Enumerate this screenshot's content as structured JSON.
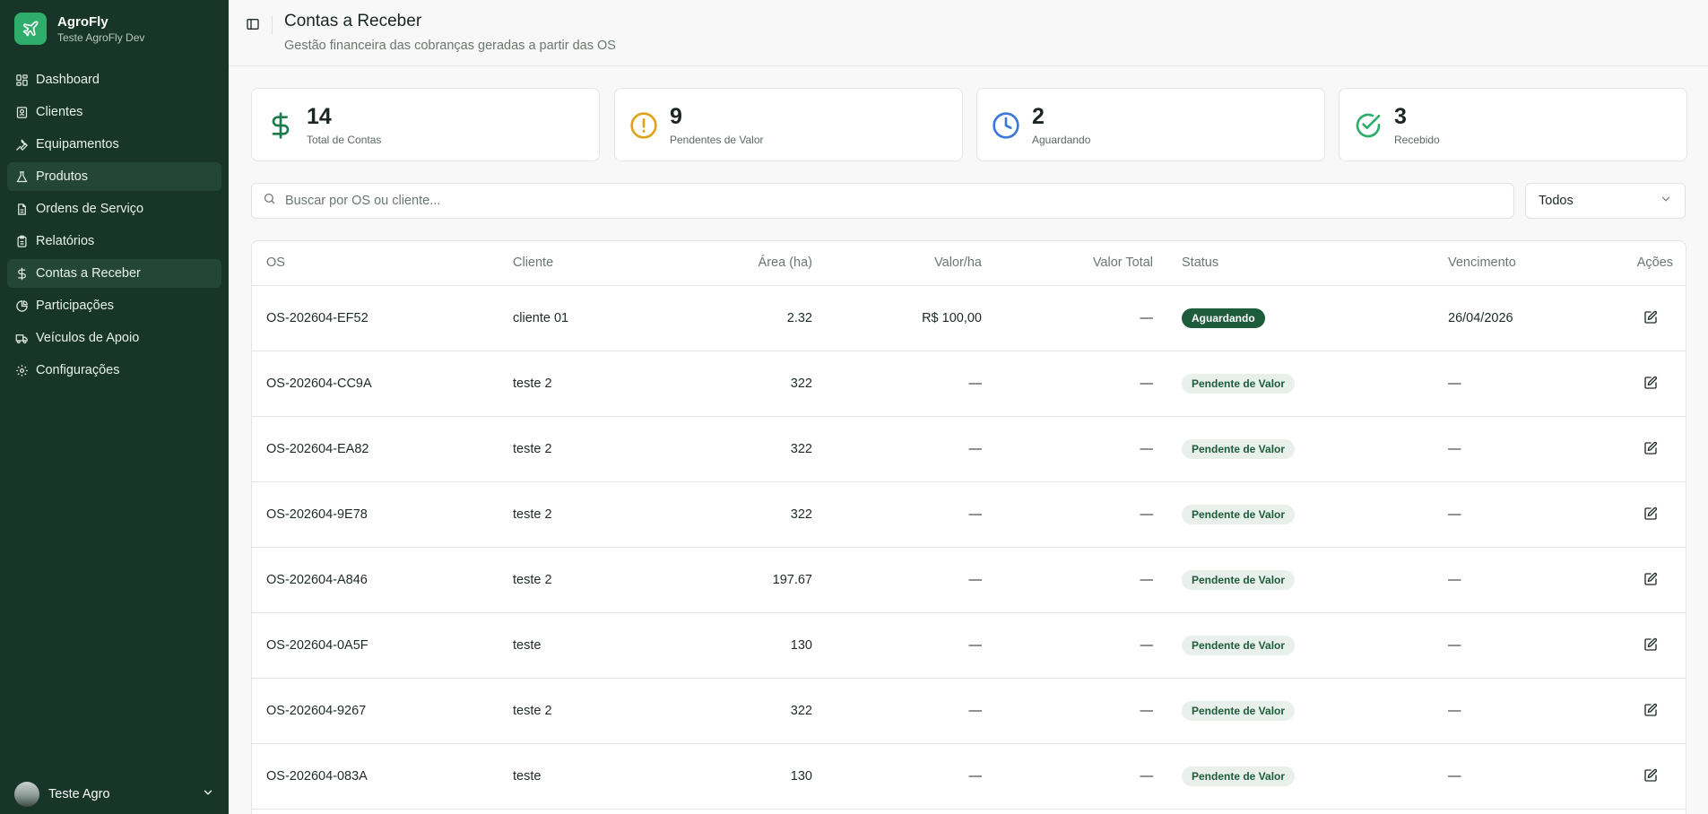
{
  "brand": {
    "name": "AgroFly",
    "subtitle": "Teste AgroFly Dev"
  },
  "sidebar": {
    "items": [
      {
        "label": "Dashboard",
        "icon": "grid-icon"
      },
      {
        "label": "Clientes",
        "icon": "contact-icon"
      },
      {
        "label": "Equipamentos",
        "icon": "wrench-icon"
      },
      {
        "label": "Produtos",
        "icon": "flask-icon"
      },
      {
        "label": "Ordens de Serviço",
        "icon": "file-icon"
      },
      {
        "label": "Relatórios",
        "icon": "clipboard-icon"
      },
      {
        "label": "Contas a Receber",
        "icon": "dollar-icon"
      },
      {
        "label": "Participações",
        "icon": "pie-chart-icon"
      },
      {
        "label": "Veículos de Apoio",
        "icon": "truck-icon"
      },
      {
        "label": "Configurações",
        "icon": "gear-icon"
      }
    ],
    "user": {
      "name": "Teste Agro"
    }
  },
  "header": {
    "title": "Contas a Receber",
    "subtitle": "Gestão financeira das cobranças geradas a partir das OS"
  },
  "stats": [
    {
      "value": "14",
      "label": "Total de Contas",
      "icon": "dollar-icon",
      "color": "#1d7a4c"
    },
    {
      "value": "9",
      "label": "Pendentes de Valor",
      "icon": "alert-circle-icon",
      "color": "#e0a219"
    },
    {
      "value": "2",
      "label": "Aguardando",
      "icon": "clock-icon",
      "color": "#3c78d8"
    },
    {
      "value": "3",
      "label": "Recebido",
      "icon": "check-circle-icon",
      "color": "#2fae6b"
    }
  ],
  "search": {
    "placeholder": "Buscar por OS ou cliente..."
  },
  "filter": {
    "value": "Todos"
  },
  "table": {
    "headers": [
      "OS",
      "Cliente",
      "Área (ha)",
      "Valor/ha",
      "Valor Total",
      "Status",
      "Vencimento",
      "Ações"
    ],
    "rows": [
      {
        "os": "OS-202604-EF52",
        "cliente": "cliente 01",
        "area": "2.32",
        "valor_ha": "R$ 100,00",
        "valor_total": "—",
        "status": "Aguardando",
        "vencimento": "26/04/2026"
      },
      {
        "os": "OS-202604-CC9A",
        "cliente": "teste 2",
        "area": "322",
        "valor_ha": "—",
        "valor_total": "—",
        "status": "Pendente de Valor",
        "vencimento": "—"
      },
      {
        "os": "OS-202604-EA82",
        "cliente": "teste 2",
        "area": "322",
        "valor_ha": "—",
        "valor_total": "—",
        "status": "Pendente de Valor",
        "vencimento": "—"
      },
      {
        "os": "OS-202604-9E78",
        "cliente": "teste 2",
        "area": "322",
        "valor_ha": "—",
        "valor_total": "—",
        "status": "Pendente de Valor",
        "vencimento": "—"
      },
      {
        "os": "OS-202604-A846",
        "cliente": "teste 2",
        "area": "197.67",
        "valor_ha": "—",
        "valor_total": "—",
        "status": "Pendente de Valor",
        "vencimento": "—"
      },
      {
        "os": "OS-202604-0A5F",
        "cliente": "teste",
        "area": "130",
        "valor_ha": "—",
        "valor_total": "—",
        "status": "Pendente de Valor",
        "vencimento": "—"
      },
      {
        "os": "OS-202604-9267",
        "cliente": "teste 2",
        "area": "322",
        "valor_ha": "—",
        "valor_total": "—",
        "status": "Pendente de Valor",
        "vencimento": "—"
      },
      {
        "os": "OS-202604-083A",
        "cliente": "teste",
        "area": "130",
        "valor_ha": "—",
        "valor_total": "—",
        "status": "Pendente de Valor",
        "vencimento": "—"
      }
    ]
  }
}
